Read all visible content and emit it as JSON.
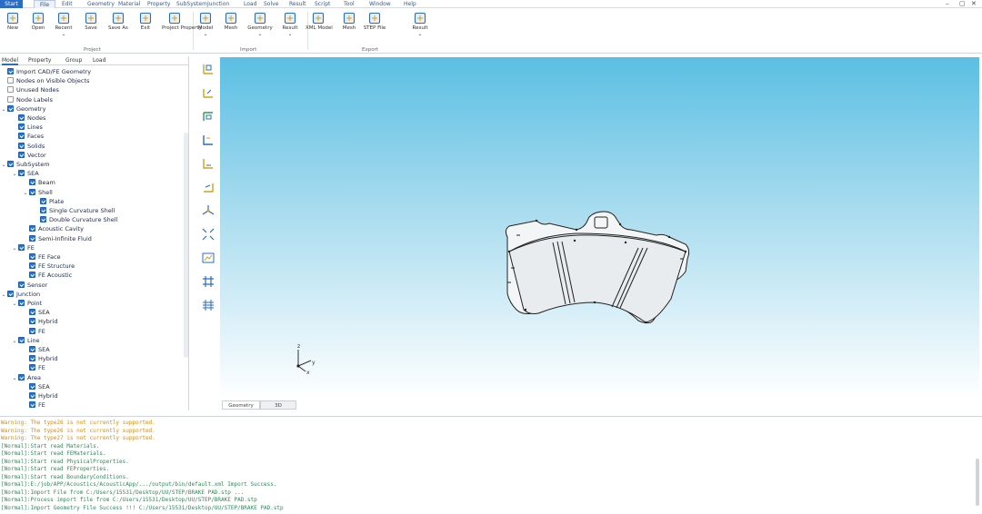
{
  "menubar": {
    "items": [
      "Start",
      "File",
      "Edit",
      "Geometry",
      "Material",
      "Property",
      "SubSystem",
      "Junction",
      "Load",
      "Solve",
      "Result",
      "Script",
      "Tool",
      "Window",
      "Help"
    ],
    "controls": [
      "–",
      "▢",
      "✕"
    ]
  },
  "toolbar": {
    "buttons": [
      {
        "label": "New",
        "icon": "new-file-icon"
      },
      {
        "label": "Open",
        "icon": "open-folder-icon"
      },
      {
        "label": "Recent",
        "icon": "recent-files-icon",
        "dropdown": true
      },
      {
        "label": "Save",
        "icon": "save-icon"
      },
      {
        "label": "Save As",
        "icon": "save-as-icon"
      },
      {
        "label": "Exit",
        "icon": "exit-icon"
      },
      {
        "label": "Project Property",
        "icon": "gear-icon"
      },
      {
        "label": "Model",
        "icon": "import-model-icon",
        "dropdown": true
      },
      {
        "label": "Mesh",
        "icon": "import-mesh-icon"
      },
      {
        "label": "Geometry",
        "icon": "import-geometry-icon",
        "dropdown": true
      },
      {
        "label": "Result",
        "icon": "import-result-icon",
        "dropdown": true
      },
      {
        "label": "XML Model",
        "icon": "export-xml-model-icon"
      },
      {
        "label": "Mesh",
        "icon": "export-mesh-icon"
      },
      {
        "label": "STEP File",
        "icon": "export-step-icon"
      },
      {
        "label": "Result",
        "icon": "export-result-icon",
        "dropdown": true
      }
    ],
    "groups": [
      "Project",
      "Import",
      "Export"
    ]
  },
  "panel": {
    "tabs": [
      "Model",
      "Property",
      "Group",
      "Load"
    ],
    "tree": [
      {
        "label": "Import CAD/FE Geometry",
        "level": 0,
        "checked": true,
        "chevron": ""
      },
      {
        "label": "Nodes on Visible Objects",
        "level": 0,
        "checked": false,
        "chevron": ""
      },
      {
        "label": "Unused Nodes",
        "level": 0,
        "checked": false,
        "chevron": ""
      },
      {
        "label": "Node Labels",
        "level": 0,
        "checked": false,
        "chevron": ""
      },
      {
        "label": "Geometry",
        "level": 0,
        "checked": true,
        "chevron": "v"
      },
      {
        "label": "Nodes",
        "level": 1,
        "checked": true,
        "chevron": ""
      },
      {
        "label": "Lines",
        "level": 1,
        "checked": true,
        "chevron": ""
      },
      {
        "label": "Faces",
        "level": 1,
        "checked": true,
        "chevron": ""
      },
      {
        "label": "Solids",
        "level": 1,
        "checked": true,
        "chevron": ""
      },
      {
        "label": "Vector",
        "level": 1,
        "checked": true,
        "chevron": ""
      },
      {
        "label": "SubSystem",
        "level": 0,
        "checked": true,
        "chevron": "v"
      },
      {
        "label": "SEA",
        "level": 1,
        "checked": true,
        "chevron": "v"
      },
      {
        "label": "Beam",
        "level": 2,
        "checked": true,
        "chevron": ""
      },
      {
        "label": "Shell",
        "level": 2,
        "checked": true,
        "chevron": "v"
      },
      {
        "label": "Plate",
        "level": 3,
        "checked": true,
        "chevron": ""
      },
      {
        "label": "Single Curvature Shell",
        "level": 3,
        "checked": true,
        "chevron": ""
      },
      {
        "label": "Double Curvature Shell",
        "level": 3,
        "checked": true,
        "chevron": ""
      },
      {
        "label": "Acoustic Cavity",
        "level": 2,
        "checked": true,
        "chevron": ""
      },
      {
        "label": "Semi-Infinite Fluid",
        "level": 2,
        "checked": true,
        "chevron": ""
      },
      {
        "label": "FE",
        "level": 1,
        "checked": true,
        "chevron": "v"
      },
      {
        "label": "FE Face",
        "level": 2,
        "checked": true,
        "chevron": ""
      },
      {
        "label": "FE Structure",
        "level": 2,
        "checked": true,
        "chevron": ""
      },
      {
        "label": "FE Acoustic",
        "level": 2,
        "checked": true,
        "chevron": ""
      },
      {
        "label": "Sensor",
        "level": 1,
        "checked": true,
        "chevron": ""
      },
      {
        "label": "Junction",
        "level": 0,
        "checked": true,
        "chevron": "v"
      },
      {
        "label": "Point",
        "level": 1,
        "checked": true,
        "chevron": "v"
      },
      {
        "label": "SEA",
        "level": 2,
        "checked": true,
        "chevron": ""
      },
      {
        "label": "Hybrid",
        "level": 2,
        "checked": true,
        "chevron": ""
      },
      {
        "label": "FE",
        "level": 2,
        "checked": true,
        "chevron": ""
      },
      {
        "label": "Line",
        "level": 1,
        "checked": true,
        "chevron": "v"
      },
      {
        "label": "SEA",
        "level": 2,
        "checked": true,
        "chevron": ""
      },
      {
        "label": "Hybrid",
        "level": 2,
        "checked": true,
        "chevron": ""
      },
      {
        "label": "FE",
        "level": 2,
        "checked": true,
        "chevron": ""
      },
      {
        "label": "Area",
        "level": 1,
        "checked": true,
        "chevron": "v"
      },
      {
        "label": "SEA",
        "level": 2,
        "checked": true,
        "chevron": ""
      },
      {
        "label": "Hybrid",
        "level": 2,
        "checked": true,
        "chevron": ""
      },
      {
        "label": "FE",
        "level": 2,
        "checked": true,
        "chevron": ""
      }
    ]
  },
  "viewport": {
    "tabs": [
      "Geometry",
      "3D"
    ],
    "axis_labels": {
      "x": "x",
      "y": "y",
      "z": "z"
    }
  },
  "console": {
    "lines": [
      {
        "text": "Warning: The type26 is not currently supported.",
        "kind": "warning"
      },
      {
        "text": "Warning: The type26 is not currently supported.",
        "kind": "warning"
      },
      {
        "text": "Warning: The type27 is not currently supported.",
        "kind": "warning"
      },
      {
        "text": "[Normal]:Start read Materials.",
        "kind": "normal"
      },
      {
        "text": "[Normal]:Start read FEMaterials.",
        "kind": "normal"
      },
      {
        "text": "[Normal]:Start read PhysicalProperties.",
        "kind": "normal"
      },
      {
        "text": "[Normal]:Start read FEProperties.",
        "kind": "normal"
      },
      {
        "text": "[Normal]:Start read BoundaryConditions.",
        "kind": "normal"
      },
      {
        "text": "[Normal]:E:/job/APP/Acoustics/AcousticApp/.../output/bin/default.xml Import Success.",
        "kind": "normal"
      },
      {
        "text": "[Normal]:Import File from C:/Users/15531/Desktop/UU/STEP/BRAKE PAD.stp ...",
        "kind": "normal"
      },
      {
        "text": "[Normal]:Process import file from C:/Users/15531/Desktop/UU/STEP/BRAKE PAD.stp",
        "kind": "normal"
      },
      {
        "text": "[Normal]:Import Geometry File Success !!! C:/Users/15531/Desktop/UU/STEP/BRAKE PAD.stp",
        "kind": "normal"
      }
    ]
  },
  "colors": {
    "accent": "#2b6cc4",
    "warning": "#e08a00",
    "normal": "#2e8b57",
    "sky_top": "#5bbfe3"
  }
}
